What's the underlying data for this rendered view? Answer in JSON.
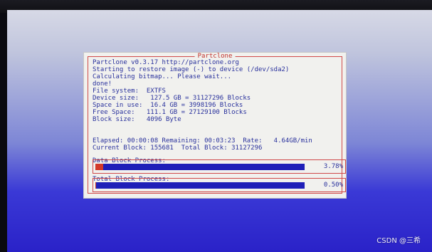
{
  "dialog": {
    "title": "Partclone",
    "lines": [
      "Partclone v0.3.17 http://partclone.org",
      "Starting to restore image (-) to device (/dev/sda2)",
      "Calculating bitmap... Please wait...",
      "done!",
      "File system:  EXTFS",
      "Device size:   127.5 GB = 31127296 Blocks",
      "Space in use:  16.4 GB = 3998196 Blocks",
      "Free Space:   111.1 GB = 27129100 Blocks",
      "Block size:   4096 Byte"
    ],
    "status_lines": [
      "Elapsed: 00:00:08 Remaining: 00:03:23  Rate:   4.64GB/min",
      "Current Block: 155681  Total Block: 31127296"
    ],
    "data_block": {
      "label": "Data Block Process:",
      "percent_text": "3.78%",
      "fraction": 0.0378
    },
    "total_block": {
      "label": "Total Block Process:",
      "percent_text": "0.50%",
      "fraction": 0.005
    }
  },
  "watermark": "CSDN @三希",
  "colors": {
    "text": "#28309c",
    "frame_red": "#d04848",
    "bar_blue": "#1f1fb8",
    "bar_fill_red": "#d23a2a",
    "dialog_bg": "#f1f1ee"
  }
}
